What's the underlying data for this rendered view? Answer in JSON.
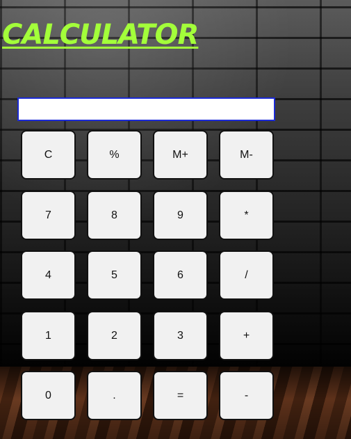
{
  "app": {
    "title": "CALCULATOR"
  },
  "display": {
    "value": ""
  },
  "keypad": {
    "rows": [
      [
        "C",
        "%",
        "M+",
        "M-"
      ],
      [
        "7",
        "8",
        "9",
        "*"
      ],
      [
        "4",
        "5",
        "6",
        "/"
      ],
      [
        "1",
        "2",
        "3",
        "+"
      ],
      [
        "0",
        ".",
        "=",
        "-"
      ]
    ]
  },
  "colors": {
    "title": "#a3ff3a",
    "display_border": "#1b2ad6",
    "button_bg": "#f1f1f1",
    "button_border": "#111111"
  }
}
